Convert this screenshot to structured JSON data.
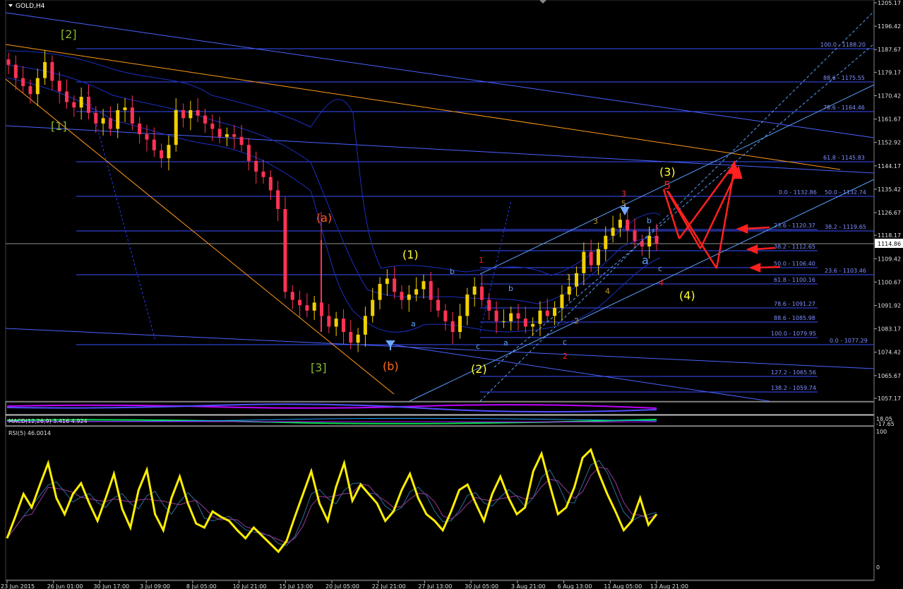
{
  "header": {
    "symbol_label": "GOLD,H4"
  },
  "colors": {
    "background": "#000000",
    "bull_candle": "#f0d000",
    "bear_candle": "#ff3355",
    "fib": "#4a62ff",
    "channel": "#5aa0ff",
    "trendline_orange": "#ff9a1a",
    "arrows": "#ff2020",
    "wave_yellow": "#ffff33",
    "wave_green": "#8ab82c",
    "wave_orange": "#ff6a1a",
    "rsi_line": "#ffee00"
  },
  "price_axis": {
    "ticks": [
      "1205.17",
      "1196.42",
      "1187.67",
      "1179.17",
      "1170.42",
      "1161.67",
      "1152.92",
      "1144.17",
      "1135.42",
      "1126.67",
      "1118.17",
      "1109.42",
      "1100.67",
      "1091.92",
      "1083.17",
      "1074.42",
      "1065.67",
      "1057.17"
    ],
    "current_price": "1114.86"
  },
  "time_axis": {
    "ticks": [
      "23 Jun 2015",
      "26 Jun 01:00",
      "30 Jun 17:00",
      "3 Jul 09:00",
      "8 Jul 05:00",
      "10 Jul 21:00",
      "15 Jul 13:00",
      "20 Jul 05:00",
      "22 Jul 21:00",
      "27 Jul 13:00",
      "30 Jul 05:00",
      "3 Aug 21:00",
      "6 Aug 13:00",
      "11 Aug 05:00",
      "13 Aug 21:00"
    ]
  },
  "fib_labels": {
    "set1": [
      "100.0 - 1188.20",
      "88.6 - 1175.55",
      "78.6 - 1164.46",
      "61.8 - 1145.83",
      "50.0 - 1132.74",
      "38.2 - 1119.65",
      "23.6 - 1103.46",
      "0.0 - 1077.29"
    ],
    "set2": [
      "0.0 - 1132.86",
      "23.6 - 1120.37",
      "38.2 - 1112.65",
      "50.0 - 1106.40",
      "61.8 - 1100.16",
      "78.6 - 1091.27",
      "88.6 - 1085.98",
      "100.0 - 1079.95",
      "127.2 - 1065.56",
      "138.2 - 1059.74"
    ]
  },
  "wave_labels": {
    "w2_green": "[2]",
    "w1_green": "[1]",
    "w3_green": "[3]",
    "a_orange": "(a)",
    "b_orange": "(b)",
    "w1_yellow": "(1)",
    "w2_yellow": "(2)",
    "w3_yellow": "(3)",
    "w4_yellow": "(4)",
    "r1": "1",
    "r2": "2",
    "r3": "3",
    "r4": "4",
    "r5": "5",
    "o1": "1",
    "o2": "2",
    "o3": "3",
    "o4": "4",
    "o5": "5",
    "a1": "a",
    "b1": "b",
    "a2": "a",
    "b2": "b",
    "c1": "c",
    "c2": "c",
    "a3": "a",
    "b3": "b",
    "c3": "c"
  },
  "macd_panel": {
    "label": "MACD(12,26,9) 3.416 4.924",
    "scale_top": "18.05",
    "scale_bottom": "-17.65"
  },
  "rsi_panel": {
    "label": "RSI(5) 46.0014",
    "scale_top": "100",
    "scale_bottom": "0"
  },
  "chart_data": {
    "type": "candlestick",
    "symbol": "GOLD",
    "timeframe": "H4",
    "ylim": [
      1057.17,
      1205.17
    ],
    "x_categories": [
      "23 Jun 2015",
      "26 Jun 01:00",
      "30 Jun 17:00",
      "3 Jul 09:00",
      "8 Jul 05:00",
      "10 Jul 21:00",
      "15 Jul 13:00",
      "20 Jul 05:00",
      "22 Jul 21:00",
      "27 Jul 13:00",
      "30 Jul 05:00",
      "3 Aug 21:00",
      "6 Aug 13:00",
      "11 Aug 05:00",
      "13 Aug 21:00"
    ],
    "close_path": [
      1182,
      1177,
      1174,
      1171,
      1177,
      1183,
      1176,
      1172,
      1168,
      1166,
      1170,
      1164,
      1160,
      1162,
      1158,
      1165,
      1166,
      1160,
      1156,
      1154,
      1150,
      1147,
      1152,
      1165,
      1162,
      1165,
      1163,
      1160,
      1158,
      1155,
      1156,
      1155,
      1152,
      1146,
      1142,
      1140,
      1135,
      1128,
      1097,
      1094,
      1092,
      1090,
      1093,
      1088,
      1084,
      1087,
      1082,
      1078,
      1081,
      1088,
      1094,
      1100,
      1102,
      1097,
      1094,
      1096,
      1098,
      1101,
      1094,
      1090,
      1086,
      1082,
      1088,
      1096,
      1099,
      1094,
      1090,
      1086,
      1086,
      1089,
      1087,
      1084,
      1085,
      1090,
      1088,
      1091,
      1096,
      1099,
      1104,
      1112,
      1107,
      1113,
      1118,
      1121,
      1124,
      1120,
      1116,
      1114,
      1118,
      1115
    ],
    "current_price": 1114.86,
    "rsi_values": [
      22,
      38,
      55,
      45,
      62,
      78,
      52,
      40,
      55,
      63,
      48,
      35,
      52,
      70,
      44,
      30,
      58,
      73,
      40,
      28,
      52,
      68,
      48,
      33,
      30,
      42,
      38,
      35,
      28,
      22,
      30,
      24,
      18,
      12,
      20,
      38,
      55,
      72,
      48,
      35,
      60,
      78,
      50,
      62,
      55,
      48,
      35,
      42,
      58,
      70,
      52,
      40,
      35,
      28,
      42,
      58,
      62,
      48,
      35,
      55,
      68,
      52,
      40,
      45,
      72,
      85,
      62,
      40,
      45,
      60,
      82,
      88,
      70,
      55,
      42,
      28,
      35,
      52,
      32,
      40
    ],
    "rsi_ylim": [
      0,
      100
    ]
  }
}
